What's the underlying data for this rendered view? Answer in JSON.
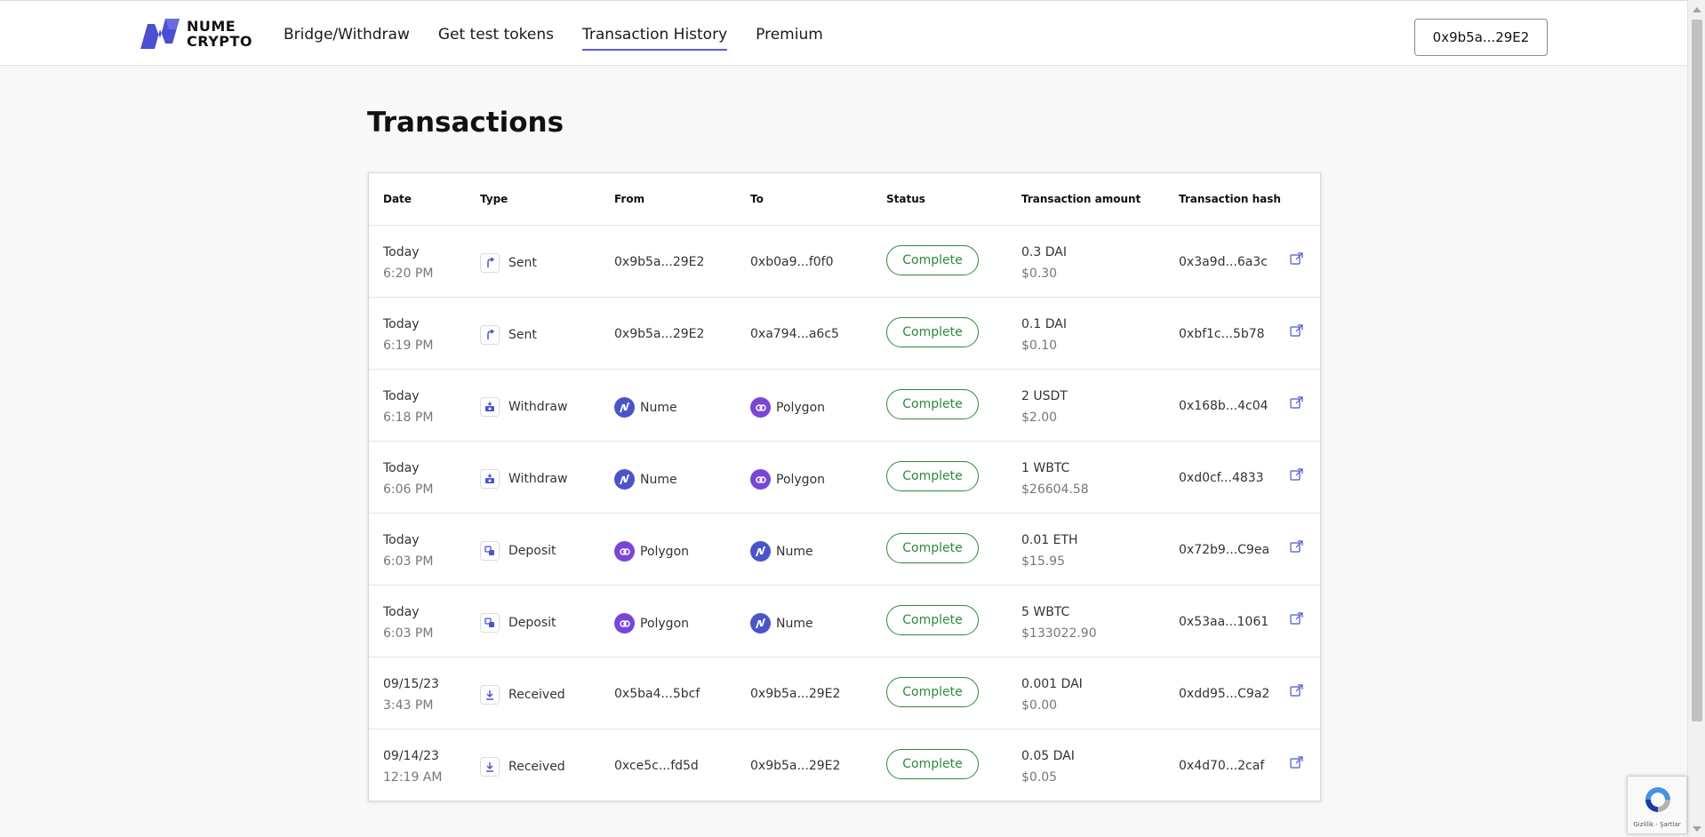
{
  "header": {
    "logo_line1": "NUME",
    "logo_line2": "CRYPTO",
    "nav": [
      {
        "label": "Bridge/Withdraw"
      },
      {
        "label": "Get test tokens"
      },
      {
        "label": "Transaction History",
        "active": true
      },
      {
        "label": "Premium"
      }
    ],
    "wallet": "0x9b5a...29E2"
  },
  "page": {
    "title": "Transactions"
  },
  "table": {
    "columns": {
      "date": "Date",
      "type": "Type",
      "from": "From",
      "to": "To",
      "status": "Status",
      "amount": "Transaction amount",
      "hash": "Transaction hash"
    },
    "rows": [
      {
        "date": "Today",
        "time": "6:20 PM",
        "type": "Sent",
        "type_icon": "send-arrow-icon",
        "from": "0x9b5a...29E2",
        "from_icon": "",
        "to": "0xb0a9...f0f0",
        "to_icon": "",
        "status": "Complete",
        "amount": "0.3 DAI",
        "usd": "$0.30",
        "hash": "0x3a9d...6a3c"
      },
      {
        "date": "Today",
        "time": "6:19 PM",
        "type": "Sent",
        "type_icon": "send-arrow-icon",
        "from": "0x9b5a...29E2",
        "from_icon": "",
        "to": "0xa794...a6c5",
        "to_icon": "",
        "status": "Complete",
        "amount": "0.1 DAI",
        "usd": "$0.10",
        "hash": "0xbf1c...5b78"
      },
      {
        "date": "Today",
        "time": "6:18 PM",
        "type": "Withdraw",
        "type_icon": "withdraw-icon",
        "from": "Nume",
        "from_icon": "nume",
        "to": "Polygon",
        "to_icon": "polygon",
        "status": "Complete",
        "amount": "2 USDT",
        "usd": "$2.00",
        "hash": "0x168b...4c04"
      },
      {
        "date": "Today",
        "time": "6:06 PM",
        "type": "Withdraw",
        "type_icon": "withdraw-icon",
        "from": "Nume",
        "from_icon": "nume",
        "to": "Polygon",
        "to_icon": "polygon",
        "status": "Complete",
        "amount": "1 WBTC",
        "usd": "$26604.58",
        "hash": "0xd0cf...4833"
      },
      {
        "date": "Today",
        "time": "6:03 PM",
        "type": "Deposit",
        "type_icon": "deposit-icon",
        "from": "Polygon",
        "from_icon": "polygon",
        "to": "Nume",
        "to_icon": "nume",
        "status": "Complete",
        "amount": "0.01 ETH",
        "usd": "$15.95",
        "hash": "0x72b9...C9ea"
      },
      {
        "date": "Today",
        "time": "6:03 PM",
        "type": "Deposit",
        "type_icon": "deposit-icon",
        "from": "Polygon",
        "from_icon": "polygon",
        "to": "Nume",
        "to_icon": "nume",
        "status": "Complete",
        "amount": "5 WBTC",
        "usd": "$133022.90",
        "hash": "0x53aa...1061"
      },
      {
        "date": "09/15/23",
        "time": "3:43 PM",
        "type": "Received",
        "type_icon": "receive-arrow-icon",
        "from": "0x5ba4...5bcf",
        "from_icon": "",
        "to": "0x9b5a...29E2",
        "to_icon": "",
        "status": "Complete",
        "amount": "0.001 DAI",
        "usd": "$0.00",
        "hash": "0xdd95...C9a2"
      },
      {
        "date": "09/14/23",
        "time": "12:19 AM",
        "type": "Received",
        "type_icon": "receive-arrow-icon",
        "from": "0xce5c...fd5d",
        "from_icon": "",
        "to": "0x9b5a...29E2",
        "to_icon": "",
        "status": "Complete",
        "amount": "0.05 DAI",
        "usd": "$0.05",
        "hash": "0x4d70...2caf"
      }
    ]
  },
  "recaptcha": {
    "text": "Gizlilik - Şartlar"
  },
  "colors": {
    "accent": "#5b5bd6",
    "status_green": "#2a8a3e",
    "nume_blue": "#4a56c8",
    "polygon_purple": "#7b45d8"
  }
}
